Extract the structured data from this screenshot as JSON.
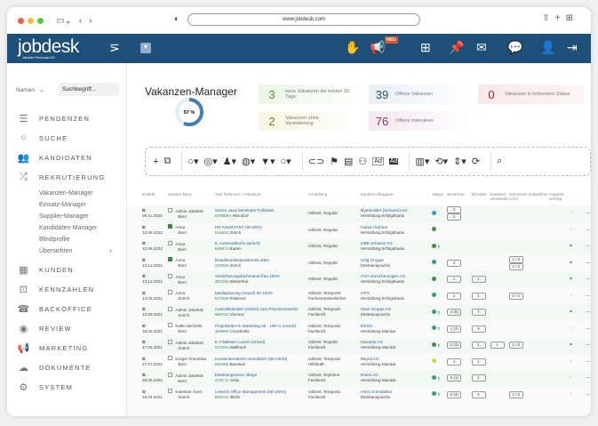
{
  "browser": {
    "url": "www.jobdesk.com"
  },
  "header": {
    "logo": "jobdesk",
    "company": "Muster Personal AG",
    "badge": "NEU",
    "icons": [
      "filter-off-icon",
      "dropdown-icon",
      "hand-icon",
      "megaphone-icon",
      "org-chart-icon",
      "pin-icon",
      "mail-icon",
      "chat-question-icon",
      "user-settings-icon",
      "logout-icon"
    ]
  },
  "sidebar": {
    "search_select": "Namen",
    "search_placeholder": "Suchbegriff...",
    "items": [
      {
        "label": "PENDENZEN",
        "icon": "checklist-icon"
      },
      {
        "label": "SUCHE",
        "icon": "search-icon"
      },
      {
        "label": "KANDIDATEN",
        "icon": "users-icon"
      },
      {
        "label": "REKRUTIERUNG",
        "icon": "shuffle-icon"
      },
      {
        "label": "KUNDEN",
        "icon": "building-icon"
      },
      {
        "label": "KENNZAHLEN",
        "icon": "presentation-icon"
      },
      {
        "label": "BACKOFFICE",
        "icon": "phone-icon"
      },
      {
        "label": "REVIEW",
        "icon": "eye-icon"
      },
      {
        "label": "MARKETING",
        "icon": "megaphone-icon"
      },
      {
        "label": "DOKUMENTE",
        "icon": "cloud-icon"
      },
      {
        "label": "SYSTEM",
        "icon": "system-icon"
      }
    ],
    "subitems": [
      "Vakanzen-Manager",
      "Einsatz-Manager",
      "Supplier-Manager",
      "Kandidaten-Manager",
      "Blindprofile",
      "Übersichten"
    ]
  },
  "page": {
    "title": "Vakanzen-Manager",
    "progress_label": "57 %",
    "progress": 57
  },
  "kpis": [
    {
      "value": "3",
      "label": "neue Vakanzen die letzten 30 Tage",
      "color": "#5a8a3a"
    },
    {
      "value": "39",
      "label": "Offene Vakanzen",
      "color": "#2a4d6f"
    },
    {
      "value": "0",
      "label": "Vakanzen in kritischem Status",
      "color": "#8a2a2a"
    },
    {
      "value": "2",
      "label": "Vakanzen ohne Veränderung",
      "color": "#7a7a3a"
    },
    {
      "value": "76",
      "label": "Offene Interviews",
      "color": "#7a3a6a"
    }
  ],
  "table": {
    "headers": [
      "Erstellt",
      "Berater Büro",
      "Titel Referenz / Arbeitsort",
      "Anstellung",
      "Kunde/Auftragsart",
      "Status",
      "Bewerber",
      "Shortlist",
      "Dossiers versendet",
      "Interviews 1/2/3",
      "Zusatzlinie",
      "Angebot Vertrag"
    ],
    "rows": [
      {
        "date": "09.11.2022",
        "checked": false,
        "berater": "Admin Jobdesk",
        "buero": "Bern",
        "title": "Senior Java Developer FullStack",
        "ref": "579889V",
        "ort": "Altendorf",
        "anst1": "Vollzeit, Regulär",
        "anst2": "",
        "kunde": "Bytebuilder (Schweiz) AG",
        "art": "Vermittlung Erfolgsbasis",
        "status": "#3a9ab8",
        "mega": false,
        "bew": "1",
        "bew2": "1",
        "short": "",
        "dos": "",
        "int": "",
        "int2": "",
        "flag": false
      },
      {
        "date": "12.08.2022",
        "checked": true,
        "berater": "Anna",
        "buero": "Bern",
        "title": "HR ASSISTANT (60-80%)",
        "ref": "515594",
        "ort": "Zürich",
        "anst1": "Vollzeit, Regulär",
        "anst2": "",
        "kunde": "Huber+Suhner",
        "art": "Vermittlung Erfolgsbasis",
        "status": "#4a8a4a",
        "mega": false,
        "bew": "",
        "bew2": "",
        "short": "",
        "dos": "",
        "int": "",
        "int2": "",
        "flag": false
      },
      {
        "date": "12.08.2022",
        "checked": false,
        "berater": "Anna",
        "buero": "Bern",
        "title": "5. Automatiker/in (w/m/d)",
        "ref": "649874",
        "ort": "Baden",
        "anst1": "Vollzeit, Regulär",
        "anst2": "",
        "kunde": "ABB Schweiz AG",
        "art": "Vermittlung Erfolgsbasis",
        "status": "#4a8a4a",
        "mega": true,
        "bew": "",
        "bew2": "",
        "short": "",
        "dos": "",
        "int": "",
        "int2": "",
        "flag": true
      },
      {
        "date": "13.12.2021",
        "checked": true,
        "berater": "Anna",
        "buero": "Bern",
        "title": "Detailhandelsassistent/in EBA",
        "ref": "210830",
        "ort": "Zürich",
        "anst1": "Vollzeit, Regulär",
        "anst2": "",
        "kunde": "Volg Gruppe",
        "art": "Direktansprache",
        "status": "#3a9a8a",
        "mega": false,
        "bew": "2",
        "bew2": "",
        "short": "",
        "dos": "",
        "int": "1 / 0",
        "int2": "1 / 0",
        "flag": true
      },
      {
        "date": "13.12.2021",
        "checked": false,
        "berater": "Anna",
        "buero": "Bern",
        "title": "Versicherungsfachmann/-frau 100%",
        "ref": "403292",
        "ort": "Winterthur",
        "anst1": "Vollzeit, Regulär",
        "anst2": "",
        "kunde": "AXA Versicherungen AG",
        "art": "Vermittlung Erfolgsbasis",
        "status": "#4a8a4a",
        "mega": false,
        "bew": "1",
        "bew2": "",
        "short": "1",
        "dos": "",
        "int": "",
        "int2": "",
        "flag": true
      },
      {
        "date": "14.08.2021",
        "checked": false,
        "berater": "Anna",
        "buero": "Zürich",
        "title": "Mediaplanung (m/w/d) 80-100%",
        "ref": "537806",
        "ort": "Rotkreuz",
        "anst1": "Vollzeit, Temporär",
        "anst2": "Fachverantwortlicher",
        "kunde": "APG",
        "art": "Vermittlung Erfolgsbasis",
        "status": "#3a9a8a",
        "mega": false,
        "bew": "1",
        "bew2": "",
        "short": "1",
        "dos": "",
        "int": "1 / 0",
        "int2": "",
        "flag": false
      },
      {
        "date": "13.09.2021",
        "checked": false,
        "berater": "Admin Jobdesk",
        "buero": "Zürich",
        "title": "Auszubildenden (m/w/d) zum Präzisionswerkz",
        "ref": "589754",
        "ort": "Vionnaz",
        "anst1": "Vollzeit, Temporär",
        "anst2": "Fachkraft",
        "kunde": "Insel Gruppe AG",
        "art": "Direktansprache",
        "status": "#3a9a8a",
        "mega": true,
        "bew": "4 (6)",
        "bew2": "",
        "short": "7",
        "dos": "",
        "int": "",
        "int2": "",
        "flag": true
      },
      {
        "date": "18.08.2021",
        "checked": false,
        "berater": "Keller Michelle",
        "buero": "Bern",
        "title": "Projektleiter*in Marketing 80 - 100 % (m/w/d)",
        "ref": "469865",
        "ort": "Courtételle",
        "anst1": "Vollzeit, Temporär",
        "anst2": "Fachkraft",
        "kunde": "DKSH",
        "art": "Vermittlung Mandat",
        "status": "#3a9a8a",
        "mega": true,
        "bew": "1 (3)",
        "bew2": "",
        "short": "5",
        "dos": "",
        "int": "",
        "int2": "",
        "flag": false
      },
      {
        "date": "17.06.2021",
        "checked": false,
        "berater": "Admin Jobdesk",
        "buero": "Zürich",
        "title": "5. Filialleiter Luzern (m/w/d)",
        "ref": "237094",
        "ort": "Wallbach",
        "anst1": "Vollzeit, Regulär",
        "anst2": "Fachkraft",
        "kunde": "Novartis AG",
        "art": "Vermittlung Mandat",
        "status": "#4a8a4a",
        "mega": true,
        "bew": "2 (3)",
        "bew2": "",
        "short": "1",
        "dos": "1",
        "int": "1 / 0",
        "int2": "",
        "flag": true
      },
      {
        "date": "27.07.2021",
        "checked": false,
        "berater": "Kruger Franziska",
        "buero": "Bern",
        "title": "Kundenberater/in Immobilien (80-100%)",
        "ref": "053388",
        "ort": "Bavetwil",
        "anst1": "Vollzeit, Temporär",
        "anst2": "Hilfskraft",
        "kunde": "Migrol AG",
        "art": "Vermittlung Mandat",
        "status": "#c8d84a",
        "mega": false,
        "bew": "1",
        "bew2": "",
        "short": "1",
        "dos": "",
        "int": "",
        "int2": "",
        "flag": false
      },
      {
        "date": "29.05.2021",
        "checked": false,
        "berater": "Admin Jobdesk",
        "buero": "Bern",
        "title": "Elektroingenieur übrige",
        "ref": "479171",
        "ort": "Gelio",
        "anst1": "Vollzeit, Teylohne",
        "anst2": "Fachkraft",
        "kunde": "Emmi AG",
        "art": "Vermittlung Mandat",
        "status": "#3a9a8a",
        "mega": true,
        "bew": "0 (1)",
        "bew2": "",
        "short": "1",
        "dos": "",
        "int": "",
        "int2": "",
        "flag": false
      },
      {
        "date": "16.04.2021",
        "checked": false,
        "berater": "Kaestner Sven",
        "buero": "Zürich",
        "title": "Leiter/in Office Management (60-100%)",
        "ref": "909141",
        "ort": "Ittis/N",
        "anst1": "Vollzeit, Temporär",
        "anst2": "Fachkraft",
        "kunde": "HIAG Immobilien",
        "art": "Direktansprache",
        "status": "#3a9a8a",
        "mega": true,
        "bew": "0 (3)",
        "bew2": "",
        "short": "2",
        "dos": "",
        "int": "1 / 0",
        "int2": "",
        "flag": false
      }
    ]
  }
}
